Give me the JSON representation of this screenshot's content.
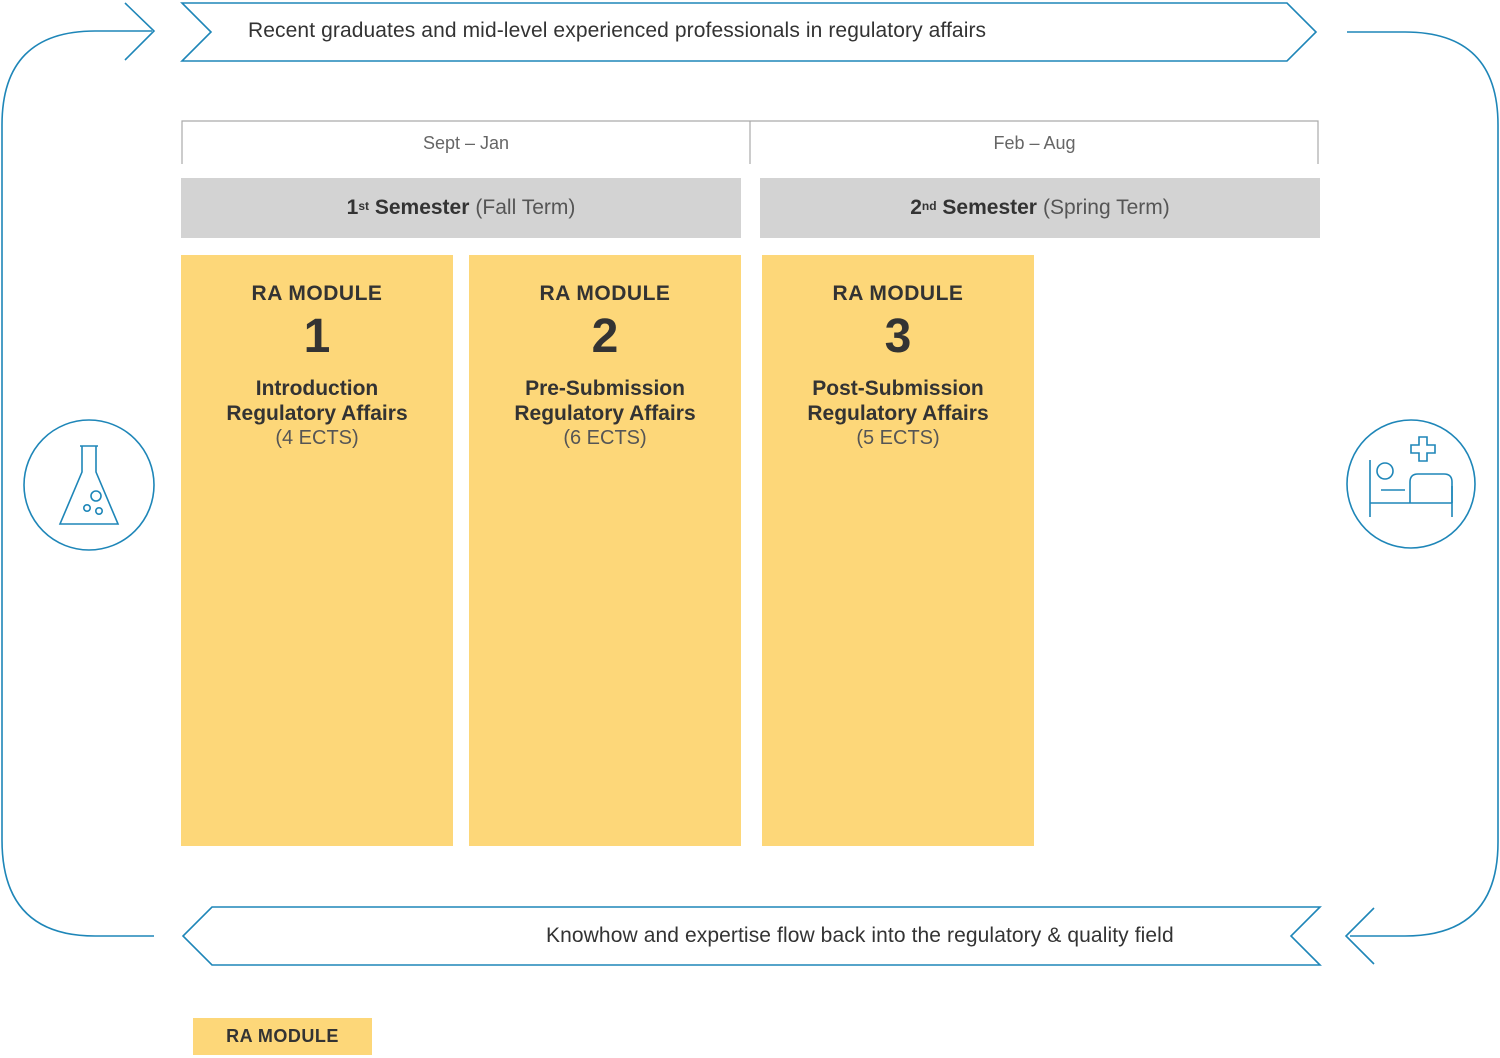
{
  "top_banner": {
    "text": "Recent graduates and mid-level experienced professionals in regulatory affairs"
  },
  "bottom_banner": {
    "text": "Knowhow and expertise flow back into the regulatory & quality field"
  },
  "periods": [
    {
      "label": "Sept – Jan"
    },
    {
      "label": "Feb – Aug"
    }
  ],
  "semesters": [
    {
      "number": "1",
      "suffix": "st",
      "label": "Semester",
      "term": "(Fall Term)"
    },
    {
      "number": "2",
      "suffix": "nd",
      "label": "Semester",
      "term": "(Spring Term)"
    }
  ],
  "modules": [
    {
      "heading": "RA MODULE",
      "number": "1",
      "title_line1": "Introduction",
      "title_line2": "Regulatory Affairs",
      "credits": "(4 ECTS)"
    },
    {
      "heading": "RA MODULE",
      "number": "2",
      "title_line1": "Pre-Submission",
      "title_line2": "Regulatory Affairs",
      "credits": "(6 ECTS)"
    },
    {
      "heading": "RA MODULE",
      "number": "3",
      "title_line1": "Post-Submission",
      "title_line2": "Regulatory Affairs",
      "credits": "(5 ECTS)"
    }
  ],
  "legend": {
    "label": "RA MODULE"
  },
  "icons": {
    "left": "flask-icon",
    "right": "hospital-bed-icon"
  },
  "colors": {
    "accent_blue": "#1e86b8",
    "module_yellow": "#fdd779",
    "semester_gray": "#d3d3d3"
  }
}
